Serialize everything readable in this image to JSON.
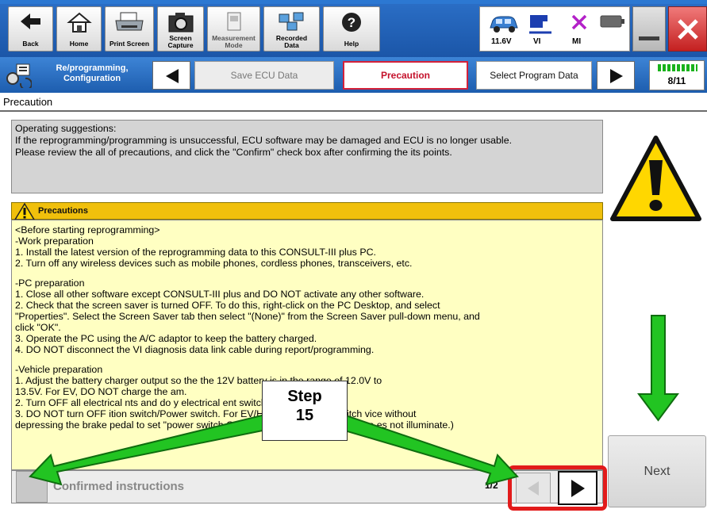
{
  "toolbar": {
    "back": "Back",
    "home": "Home",
    "print_screen": "Print Screen",
    "screen_capture": "Screen\nCapture",
    "measurement_mode": "Measurement\nMode",
    "recorded_data": "Recorded\nData",
    "help": "Help",
    "voltage": "11.6V",
    "vi": "VI",
    "mi": "MI"
  },
  "nav": {
    "mode_label": "Re/programming,\nConfiguration",
    "steps": [
      "Save ECU Data",
      "Precaution",
      "Select Program Data"
    ],
    "active_step": "Precaution",
    "page_count": "8/11"
  },
  "page": {
    "title": "Precaution"
  },
  "suggestions": {
    "heading": "Operating  suggestions:",
    "line1": "If the reprogramming/programming is unsuccessful, ECU software may be damaged and ECU is no longer usable.",
    "line2": "Please review the all of precautions, and click the \"Confirm\" check box after confirming the its points."
  },
  "precautions": {
    "header": "Precautions",
    "lines": [
      "<Before starting reprogramming>",
      "-Work  preparation",
      "1. Install the latest version of the reprogramming data to this CONSULT-III plus PC.",
      "2. Turn off any wireless devices such as mobile phones, cordless phones, transceivers, etc.",
      "",
      "-PC preparation",
      "1. Close all other software except CONSULT-III plus and DO NOT activate any other software.",
      "2. Check that the screen saver is turned OFF. To do this, right-click on the PC Desktop, and select",
      "\"Properties\". Select the Screen Saver tab then select \"(None)\" from the Screen Saver pull-down menu, and",
      "click \"OK\".",
      "3. Operate the PC using the A/C adaptor to keep the battery charged.",
      "4. DO NOT disconnect the VI diagnosis data link cable during report/programming.",
      "",
      "-Vehicle  preparation",
      "1. Adjust the battery charger output so the                                        the 12V battery is in the range of 12.0V to",
      "13.5V. For EV, DO NOT charge the                                           am.",
      "2. Turn OFF all electrical                    nts and do                                   y electrical                    ent switches.",
      "3. DO NOT turn OFF                ition switch/Power switch. For EV/HEV, push power switch                     vice without",
      "depressing the brake pedal to set \"power switch ON\". (Ready lamp in the meter pa                      es not illuminate.)"
    ]
  },
  "bottom": {
    "confirm_label": "Confirmed instructions",
    "page_indicator": "1/2"
  },
  "next_button": "Next",
  "annotation": {
    "step_label": "Step",
    "step_number": "15"
  },
  "colors": {
    "toolbar_blue": "#1f5fb4",
    "active_step_red": "#d4213a",
    "precaution_header": "#f0c00c",
    "precaution_body": "#ffffc2",
    "annotation_green": "#22c422",
    "highlight_red": "#e21b1b"
  },
  "icons": [
    "back-arrow-icon",
    "home-icon",
    "printer-icon",
    "camera-icon",
    "measurement-icon",
    "recorded-data-icon",
    "help-icon",
    "car-icon",
    "vi-icon",
    "mi-icon",
    "battery-icon",
    "minimize-icon",
    "close-icon",
    "reprogramming-icon",
    "warning-icon"
  ]
}
